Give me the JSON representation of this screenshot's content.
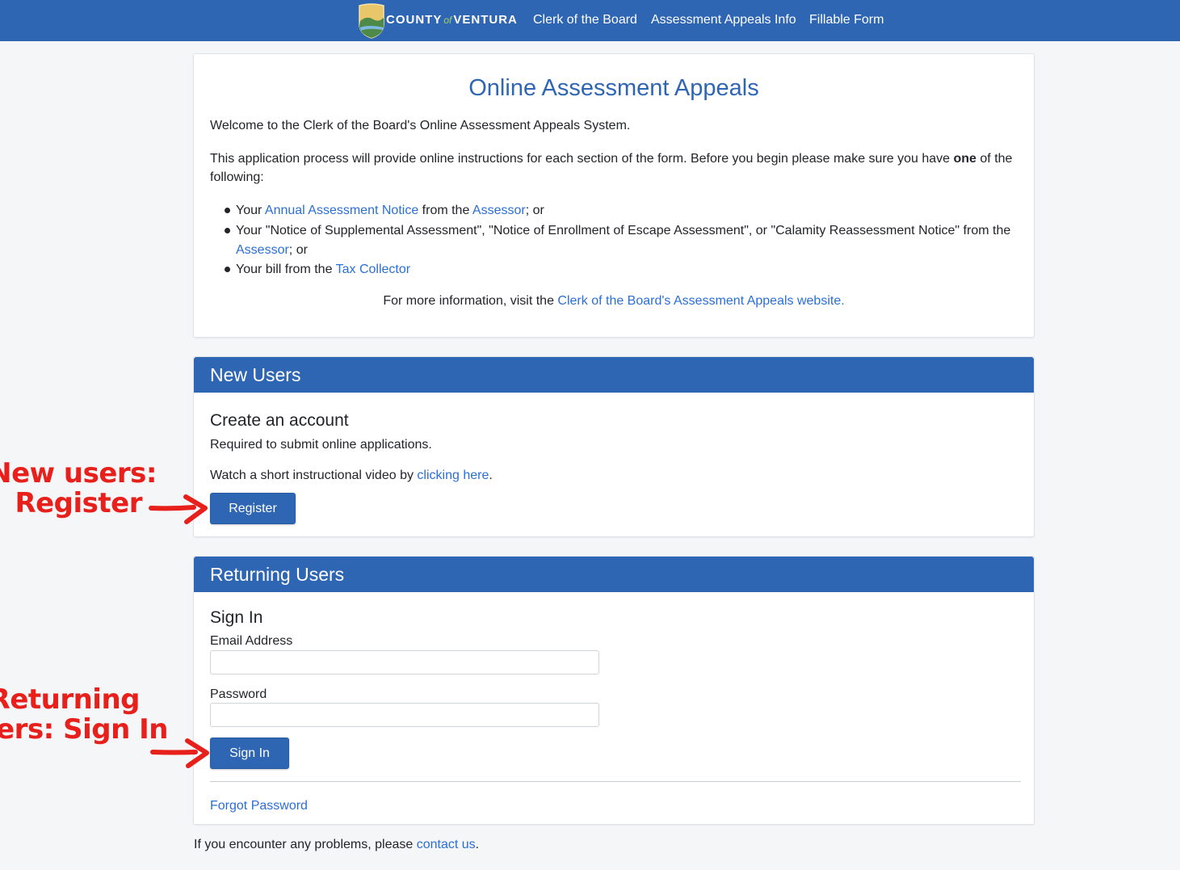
{
  "header": {
    "logo": {
      "county": "COUNTY",
      "of": "of",
      "name": "VENTURA"
    },
    "nav": [
      "Clerk of the Board",
      "Assessment Appeals Info",
      "Fillable Form"
    ],
    "bg_color": "#2f66b4"
  },
  "intro": {
    "title": "Online Assessment Appeals",
    "welcome": "Welcome to the Clerk of the Board's Online Assessment Appeals System.",
    "para_pre": "This application process will provide online instructions for each section of the form. Before you begin please make sure you have ",
    "para_bold": "one",
    "para_post": " of the",
    "para_line2": "following:",
    "bullets": {
      "b1": {
        "t1": "Your ",
        "l1": "Annual Assessment Notice",
        "t2": " from the ",
        "l2": "Assessor",
        "t3": "; or"
      },
      "b2": {
        "t1": "Your \"Notice of Supplemental Assessment\", \"Notice of Enrollment of Escape Assessment\", or \"Calamity Reassessment Notice\" from the",
        "l1": "Assessor",
        "t2": "; or"
      },
      "b3": {
        "t1": "Your bill from the ",
        "l1": "Tax Collector"
      }
    },
    "more_pre": "For more information, visit the ",
    "more_link": "Clerk of the Board's Assessment Appeals website."
  },
  "new_users": {
    "heading": "New Users",
    "subheading": "Create an account",
    "desc": "Required to submit online applications.",
    "video_pre": "Watch a short instructional video by ",
    "video_link": "clicking here",
    "video_post": ".",
    "register_label": "Register"
  },
  "returning_users": {
    "heading": "Returning Users",
    "subheading": "Sign In",
    "email_label": "Email Address",
    "email_value": "",
    "password_label": "Password",
    "password_value": "",
    "signin_label": "Sign In",
    "forgot_label": "Forgot Password"
  },
  "footer": {
    "pre": "If you encounter any problems, please ",
    "link": "contact us",
    "post": "."
  },
  "annotations": {
    "new_line1": "New users:",
    "new_line2": "Register",
    "ret_line1": "Returning",
    "ret_line2": "users: Sign In",
    "color": "#e8201c"
  }
}
